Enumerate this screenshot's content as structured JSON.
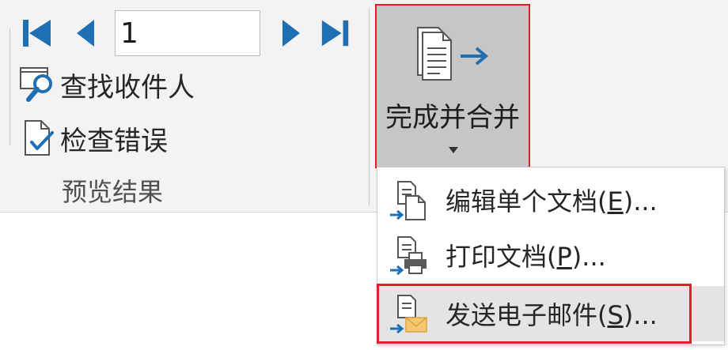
{
  "navigation": {
    "first_record": "first-record",
    "previous_record": "previous-record",
    "record_number": "1",
    "next_record": "next-record",
    "last_record": "last-record"
  },
  "preview_group": {
    "find_recipient_label": "查找收件人",
    "check_errors_label": "检查错误",
    "group_label": "预览结果"
  },
  "finish_group": {
    "finish_merge_label": "完成并合并"
  },
  "menu": {
    "items": [
      {
        "pre": "编辑单个文档(",
        "key": "E",
        "post": ")..."
      },
      {
        "pre": "打印文档(",
        "key": "P",
        "post": ")..."
      },
      {
        "pre": "发送电子邮件(",
        "key": "S",
        "post": ")..."
      }
    ]
  },
  "colors": {
    "accent_blue": "#1f6fb5",
    "highlight_red": "#e01f26",
    "button_pressed_gray": "#c6c6c6",
    "envelope_yellow": "#f5c86e"
  },
  "icons": {
    "first": "first-record-icon",
    "previous": "previous-record-icon",
    "next": "next-record-icon",
    "last": "last-record-icon",
    "find": "find-recipient-icon",
    "check": "check-errors-icon",
    "finish": "finish-merge-icon",
    "edit_docs": "edit-documents-icon",
    "print": "print-documents-icon",
    "email": "send-email-icon"
  }
}
